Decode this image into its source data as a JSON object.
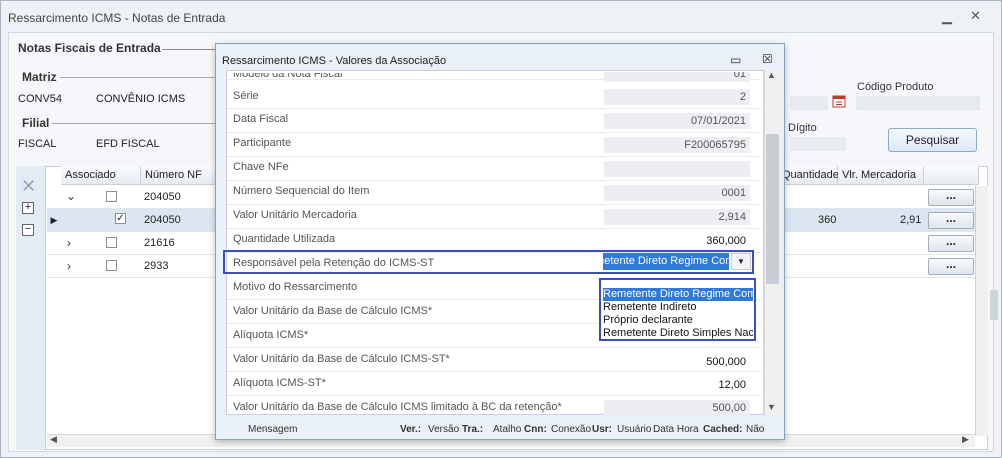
{
  "main_window": {
    "title": "Ressarcimento ICMS - Notas de Entrada",
    "group_title": "Notas Fiscais de Entrada",
    "matriz": {
      "label": "Matriz",
      "code": "CONV54",
      "name": "CONVÊNIO ICMS"
    },
    "filial": {
      "label": "Filial",
      "code": "FISCAL",
      "name": "EFD FISCAL"
    },
    "codigo_produto_label": "Código Produto",
    "digito_label": "Dígito",
    "pesquisar_label": "Pesquisar",
    "grid": {
      "headers": {
        "associado": "Associado",
        "numero_nf": "Número NF",
        "quantidade": "Quantidade",
        "vlr_mercadoria": "Vlr. Mercadoria"
      },
      "rows": [
        {
          "nf": "204050",
          "checked": false,
          "quantidade": "",
          "vlr": ""
        },
        {
          "nf": "204050",
          "checked": true,
          "quantidade": "360",
          "vlr": "2,91"
        },
        {
          "nf": "21616",
          "checked": false,
          "quantidade": "",
          "vlr": ""
        },
        {
          "nf": "2933",
          "checked": false,
          "quantidade": "",
          "vlr": ""
        }
      ],
      "action_label": "..."
    }
  },
  "dialog": {
    "title": "Ressarcimento ICMS - Valores da Associação",
    "fields": [
      {
        "label": "Modelo da Nota Fiscal",
        "value": "01"
      },
      {
        "label": "Série",
        "value": "2"
      },
      {
        "label": "Data Fiscal",
        "value": "07/01/2021"
      },
      {
        "label": "Participante",
        "value": "F200065795"
      },
      {
        "label": "Chave NFe",
        "value": ""
      },
      {
        "label": "Número Sequencial do Item",
        "value": "0001"
      },
      {
        "label": "Valor Unitário Mercadoria",
        "value": "2,914"
      },
      {
        "label": "Quantidade Utilizada",
        "value": "360,000"
      },
      {
        "label": "Responsável pela Retenção do ICMS-ST",
        "value": "Remetente Direto Regime Comum"
      },
      {
        "label": "Motivo do Ressarcimento",
        "value": ""
      },
      {
        "label": "Valor Unitário da Base de Cálculo ICMS*",
        "value": ""
      },
      {
        "label": "Alíquota ICMS*",
        "value": ""
      },
      {
        "label": "Valor Unitário da Base de Cálculo ICMS-ST*",
        "value": "500,000"
      },
      {
        "label": "Alíquota ICMS-ST*",
        "value": "12,00"
      },
      {
        "label": "Valor Unitário da Base de Cálculo ICMS limitado à BC da retenção*",
        "value": "500,00"
      }
    ],
    "dropdown_options": [
      "Remetente Direto Regime Comum",
      "Remetente Indireto",
      "Próprio declarante",
      "Remetente Direto Simples Nacional"
    ],
    "status_bar": {
      "mensagem": "Mensagem",
      "ver_label": "Ver.:",
      "ver_value": "Versão",
      "tra_label": "Tra.:",
      "tra_value": "Atalho",
      "cnn_label": "Cnn:",
      "cnn_value": "Conexão",
      "usr_label": "Usr:",
      "usr_value": "Usuário",
      "data_hora": "Data Hora",
      "cached_label": "Cached:",
      "cached_value": "Não"
    }
  }
}
